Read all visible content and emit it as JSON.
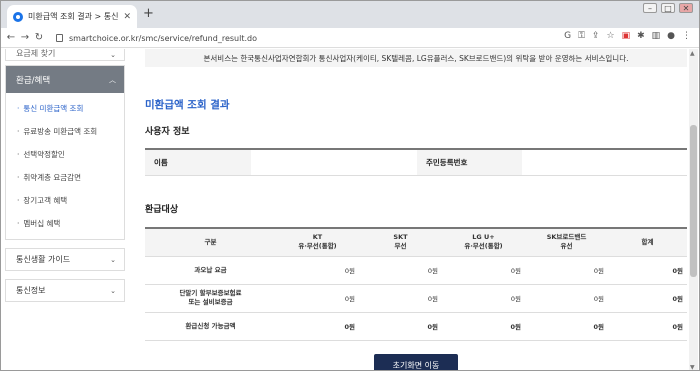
{
  "browser": {
    "tab_title": "미환급액 조회 결과 > 통신 미환",
    "tab_close": "✕",
    "new_tab": "+",
    "url": "smartchoice.or.kr/smc/service/refund_result.do",
    "window_controls": [
      "–",
      "□",
      "✕"
    ]
  },
  "sidebar": {
    "top_label": "요금제 찾기",
    "section_title": "환급/혜택",
    "items": [
      {
        "label": "통신 미환급액 조회",
        "active": true
      },
      {
        "label": "유료방송 미환급액 조회"
      },
      {
        "label": "선택약정할인"
      },
      {
        "label": "취약계층 요금감면"
      },
      {
        "label": "장기고객 혜택"
      },
      {
        "label": "멤버십 혜택"
      }
    ],
    "sections": [
      {
        "label": "통신생활 가이드"
      },
      {
        "label": "통신정보"
      }
    ]
  },
  "main": {
    "notice": "본서비스는 한국통신사업자연합회가 통신사업자(케이티, SK텔레콤, LG유플러스, SK브로드밴드)의 위탁을 받아 운영하는 서비스입니다.",
    "page_title": "미환급액 조회 결과",
    "user_info_title": "사용자 정보",
    "user_info": {
      "name_label": "이름",
      "name_value": "",
      "rrn_label": "주민등록번호",
      "rrn_value": ""
    },
    "refund_title": "환급대상",
    "table": {
      "headers": [
        {
          "l1": "구분",
          "l2": ""
        },
        {
          "l1": "KT",
          "l2": "유·무선(통합)"
        },
        {
          "l1": "SKT",
          "l2": "무선"
        },
        {
          "l1": "LG U+",
          "l2": "유·무선(통합)"
        },
        {
          "l1": "SK브로드밴드",
          "l2": "유선"
        },
        {
          "l1": "합계",
          "l2": ""
        }
      ],
      "rows": [
        {
          "label1": "과오납 요금",
          "label2": "",
          "values": [
            "0원",
            "0원",
            "0원",
            "0원",
            "0원"
          ]
        },
        {
          "label1": "단말기 할부보증보험료",
          "label2": "또는 설비보증금",
          "values": [
            "0원",
            "0원",
            "0원",
            "0원",
            "0원"
          ]
        },
        {
          "label1": "환급신청 가능금액",
          "label2": "",
          "values": [
            "0원",
            "0원",
            "0원",
            "0원",
            "0원"
          ],
          "total": true
        }
      ]
    },
    "button_label": "초기화면 이동"
  },
  "colors": {
    "accent": "#2a62c9",
    "sidebar_head": "#747b84",
    "button": "#1c2d54"
  }
}
